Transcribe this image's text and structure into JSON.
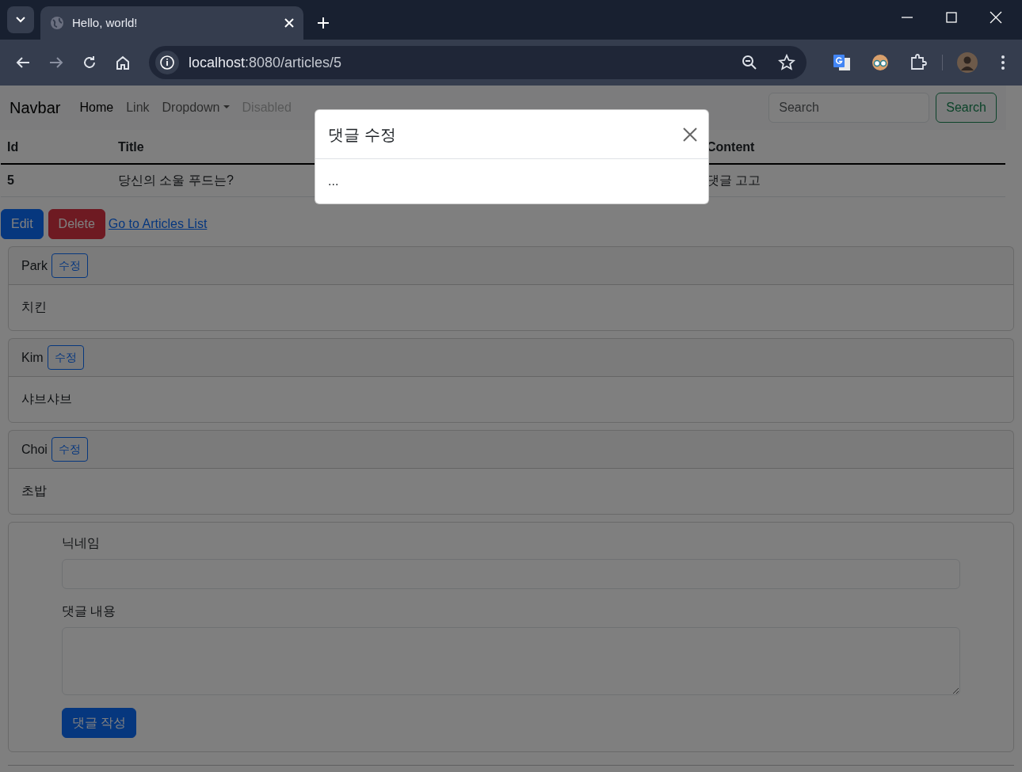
{
  "browser": {
    "tab_title": "Hello, world!",
    "url_host": "localhost",
    "url_rest": ":8080/articles/5"
  },
  "navbar": {
    "brand": "Navbar",
    "items": [
      {
        "label": "Home",
        "kind": "link",
        "selected": true,
        "disabled": false
      },
      {
        "label": "Link",
        "kind": "link",
        "selected": false,
        "disabled": false
      },
      {
        "label": "Dropdown",
        "kind": "dropdown",
        "selected": false,
        "disabled": false
      },
      {
        "label": "Disabled",
        "kind": "link",
        "selected": false,
        "disabled": true
      }
    ],
    "search": {
      "placeholder": "Search",
      "button": "Search"
    }
  },
  "table": {
    "columns": [
      "Id",
      "Title",
      "Content"
    ],
    "rows": [
      [
        "5",
        "당신의 소울 푸드는?",
        "댓글 고고"
      ]
    ]
  },
  "actions": {
    "edit": "Edit",
    "delete": "Delete",
    "link": "Go to Articles List"
  },
  "comments": [
    {
      "nickname": "Park",
      "button": "수정",
      "body": "치킨"
    },
    {
      "nickname": "Kim",
      "button": "수정",
      "body": "샤브샤브"
    },
    {
      "nickname": "Choi",
      "button": "수정",
      "body": "초밥"
    }
  ],
  "form": {
    "nickname_label": "닉네임",
    "content_label": "댓글 내용",
    "submit": "댓글 작성"
  },
  "modal": {
    "title": "댓글 수정",
    "body": "..."
  }
}
